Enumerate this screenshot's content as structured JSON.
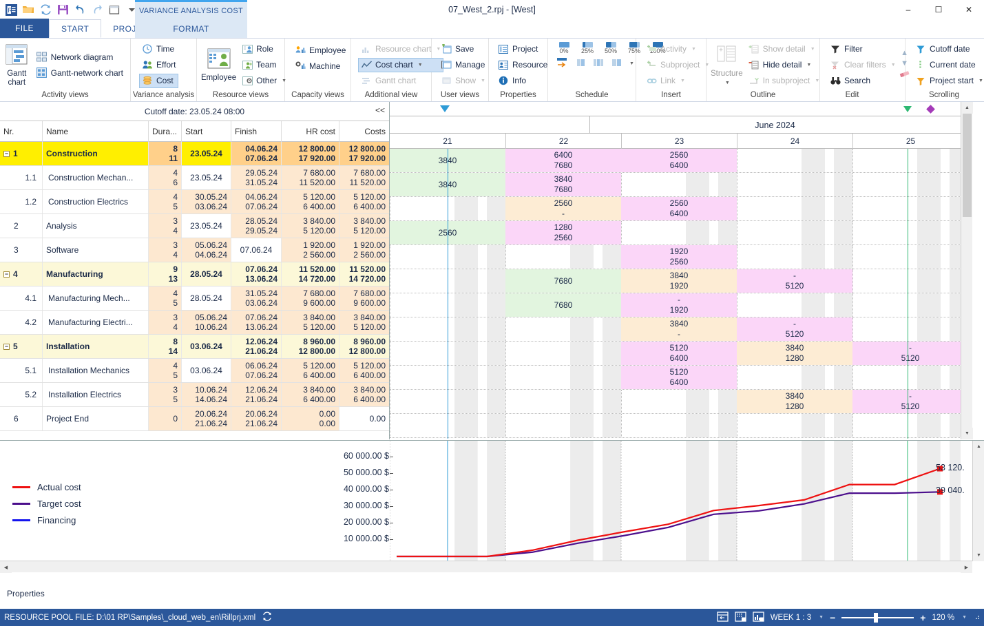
{
  "window": {
    "title": "07_West_2.rpj - [West]",
    "minimize": "–",
    "maximize": "☐",
    "close": "✕"
  },
  "quick_access": [
    {
      "name": "app-logo-icon",
      "label": "RP"
    },
    {
      "name": "open-icon",
      "label": "Open"
    },
    {
      "name": "refresh-icon",
      "label": "Refresh"
    },
    {
      "name": "save-icon",
      "label": "Save"
    },
    {
      "name": "undo-icon",
      "label": "Undo"
    },
    {
      "name": "redo-icon",
      "label": "Redo"
    },
    {
      "name": "window-icon",
      "label": "Window"
    },
    {
      "name": "qat-more-icon",
      "label": "More"
    }
  ],
  "tabs": {
    "file": "FILE",
    "items": [
      "START",
      "PROJECT"
    ],
    "active": "START",
    "contextual_title": "VARIANCE ANALYSIS COST",
    "contextual_tab": "FORMAT"
  },
  "ribbon": {
    "groups": [
      {
        "label": "Activity views",
        "big": {
          "label1": "Gantt",
          "label2": "chart",
          "icon": "gantt-chart-icon"
        },
        "items": [
          {
            "label": "Network diagram",
            "icon": "network-diagram-icon",
            "disabled": false,
            "caret": false
          },
          {
            "label": "Gantt-network chart",
            "icon": "gantt-network-icon",
            "disabled": false,
            "caret": false
          }
        ]
      },
      {
        "label": "Variance analysis",
        "items": [
          {
            "label": "Time",
            "icon": "clock-icon",
            "disabled": false,
            "caret": false
          },
          {
            "label": "Effort",
            "icon": "people-icon",
            "disabled": false,
            "caret": false
          },
          {
            "label": "Cost",
            "icon": "coins-icon",
            "disabled": false,
            "caret": false,
            "selected": true
          }
        ]
      },
      {
        "label": "Resource views",
        "big": {
          "label1": "Employee",
          "label2": "",
          "icon": "employee-grid-icon"
        },
        "items": [
          {
            "label": "Role",
            "icon": "role-icon",
            "disabled": false,
            "caret": false
          },
          {
            "label": "Team",
            "icon": "team-icon",
            "disabled": false,
            "caret": false
          },
          {
            "label": "Other",
            "icon": "other-icon",
            "disabled": false,
            "caret": true
          }
        ]
      },
      {
        "label": "Capacity views",
        "items": [
          {
            "label": "Employee",
            "icon": "employee-bars-icon",
            "disabled": false,
            "caret": false
          },
          {
            "label": "Machine",
            "icon": "machine-bars-icon",
            "disabled": false,
            "caret": false
          }
        ]
      },
      {
        "label": "Additional view",
        "items": [
          {
            "label": "Resource chart",
            "icon": "resource-chart-icon",
            "disabled": true,
            "caret": true
          },
          {
            "label": "Cost chart",
            "icon": "cost-chart-icon",
            "disabled": false,
            "caret": true,
            "selected": true
          },
          {
            "label": "Gantt chart",
            "icon": "gantt-small-icon",
            "disabled": true,
            "caret": false
          }
        ]
      },
      {
        "label": "User views",
        "items": [
          {
            "label": "Save",
            "icon": "save-view-icon",
            "disabled": false,
            "caret": false
          },
          {
            "label": "Manage",
            "icon": "manage-view-icon",
            "disabled": false,
            "caret": false
          },
          {
            "label": "Show",
            "icon": "show-view-icon",
            "disabled": true,
            "caret": true
          }
        ]
      },
      {
        "label": "Properties",
        "items": [
          {
            "label": "Project",
            "icon": "project-props-icon",
            "disabled": false,
            "caret": false
          },
          {
            "label": "Resource",
            "icon": "resource-props-icon",
            "disabled": false,
            "caret": false
          },
          {
            "label": "Info",
            "icon": "info-icon",
            "disabled": false,
            "caret": false
          }
        ]
      },
      {
        "label": "Schedule",
        "percents": [
          "0%",
          "25%",
          "50%",
          "75%",
          "100%"
        ]
      },
      {
        "label": "Insert",
        "items": [
          {
            "label": "Activity",
            "icon": "insert-activity-icon",
            "disabled": true,
            "caret": true
          },
          {
            "label": "Subproject",
            "icon": "insert-subproject-icon",
            "disabled": true,
            "caret": true
          },
          {
            "label": "Link",
            "icon": "insert-link-icon",
            "disabled": true,
            "caret": true
          }
        ]
      },
      {
        "label": "Outline",
        "big": {
          "label1": "Structure",
          "label2": "",
          "icon": "structure-icon",
          "caret": true
        },
        "items": [
          {
            "label": "Show detail",
            "icon": "show-detail-icon",
            "disabled": true,
            "caret": true
          },
          {
            "label": "Hide detail",
            "icon": "hide-detail-icon",
            "disabled": false,
            "caret": true
          },
          {
            "label": "In subproject",
            "icon": "in-subproject-icon",
            "disabled": true,
            "caret": true
          }
        ]
      },
      {
        "label": "Edit",
        "items": [
          {
            "label": "Filter",
            "icon": "filter-icon",
            "disabled": false,
            "caret": false
          },
          {
            "label": "Clear filters",
            "icon": "clear-filters-icon",
            "disabled": true,
            "caret": true
          },
          {
            "label": "Search",
            "icon": "binoculars-icon",
            "disabled": false,
            "caret": false
          }
        ],
        "side": [
          {
            "name": "scroll-up-icon",
            "label": "▲"
          },
          {
            "name": "scroll-down-icon",
            "label": "▼"
          },
          {
            "name": "eraser-icon",
            "label": ""
          }
        ]
      },
      {
        "label": "Scrolling",
        "items": [
          {
            "label": "Cutoff date",
            "icon": "cutoff-date-icon",
            "disabled": false,
            "caret": false
          },
          {
            "label": "Current date",
            "icon": "current-date-icon",
            "disabled": false,
            "caret": false
          },
          {
            "label": "Project start",
            "icon": "project-start-icon",
            "disabled": false,
            "caret": true
          }
        ]
      }
    ]
  },
  "table": {
    "cutoff_text": "Cutoff date: 23.05.24 08:00",
    "collapse_label": "<<",
    "columns": [
      "Nr.",
      "Name",
      "Dura...",
      "Start",
      "Finish",
      "HR cost",
      "Costs"
    ],
    "rows": [
      {
        "nr": "1",
        "name": "Construction",
        "dur1": "8",
        "dur2": "11",
        "start1": "23.05.24",
        "start2": "",
        "fin1": "04.06.24",
        "fin2": "07.06.24",
        "hr1": "12 800.00",
        "hr2": "17 920.00",
        "c1": "12 800.00",
        "c2": "17 920.00",
        "summary": true,
        "selected": true,
        "expander": true,
        "indent": 0
      },
      {
        "nr": "1.1",
        "name": "Construction Mechan...",
        "dur1": "4",
        "dur2": "6",
        "start1": "23.05.24",
        "start2": "",
        "fin1": "29.05.24",
        "fin2": "31.05.24",
        "hr1": "7 680.00",
        "hr2": "11 520.00",
        "c1": "7 680.00",
        "c2": "11 520.00",
        "summary": false,
        "selected": false,
        "expander": false,
        "indent": 1
      },
      {
        "nr": "1.2",
        "name": "Construction Electrics",
        "dur1": "4",
        "dur2": "5",
        "start1": "30.05.24",
        "start2": "03.06.24",
        "fin1": "04.06.24",
        "fin2": "07.06.24",
        "hr1": "5 120.00",
        "hr2": "6 400.00",
        "c1": "5 120.00",
        "c2": "6 400.00",
        "summary": false,
        "selected": false,
        "expander": false,
        "indent": 1
      },
      {
        "nr": "2",
        "name": "Analysis",
        "dur1": "3",
        "dur2": "4",
        "start1": "23.05.24",
        "start2": "",
        "fin1": "28.05.24",
        "fin2": "29.05.24",
        "hr1": "3 840.00",
        "hr2": "5 120.00",
        "c1": "3 840.00",
        "c2": "5 120.00",
        "summary": false,
        "selected": false,
        "expander": false,
        "indent": 0
      },
      {
        "nr": "3",
        "name": "Software",
        "dur1": "3",
        "dur2": "4",
        "start1": "05.06.24",
        "start2": "04.06.24",
        "fin1": "07.06.24",
        "fin2": "",
        "hr1": "1 920.00",
        "hr2": "2 560.00",
        "c1": "1 920.00",
        "c2": "2 560.00",
        "summary": false,
        "selected": false,
        "expander": false,
        "indent": 0
      },
      {
        "nr": "4",
        "name": "Manufacturing",
        "dur1": "9",
        "dur2": "13",
        "start1": "28.05.24",
        "start2": "",
        "fin1": "07.06.24",
        "fin2": "13.06.24",
        "hr1": "11 520.00",
        "hr2": "14 720.00",
        "c1": "11 520.00",
        "c2": "14 720.00",
        "summary": true,
        "selected": false,
        "expander": true,
        "indent": 0
      },
      {
        "nr": "4.1",
        "name": "Manufacturing Mech...",
        "dur1": "4",
        "dur2": "5",
        "start1": "28.05.24",
        "start2": "",
        "fin1": "31.05.24",
        "fin2": "03.06.24",
        "hr1": "7 680.00",
        "hr2": "9 600.00",
        "c1": "7 680.00",
        "c2": "9 600.00",
        "summary": false,
        "selected": false,
        "expander": false,
        "indent": 1
      },
      {
        "nr": "4.2",
        "name": "Manufacturing Electri...",
        "dur1": "3",
        "dur2": "4",
        "start1": "05.06.24",
        "start2": "10.06.24",
        "fin1": "07.06.24",
        "fin2": "13.06.24",
        "hr1": "3 840.00",
        "hr2": "5 120.00",
        "c1": "3 840.00",
        "c2": "5 120.00",
        "summary": false,
        "selected": false,
        "expander": false,
        "indent": 1
      },
      {
        "nr": "5",
        "name": "Installation",
        "dur1": "8",
        "dur2": "14",
        "start1": "03.06.24",
        "start2": "",
        "fin1": "12.06.24",
        "fin2": "21.06.24",
        "hr1": "8 960.00",
        "hr2": "12 800.00",
        "c1": "8 960.00",
        "c2": "12 800.00",
        "summary": true,
        "selected": false,
        "expander": true,
        "indent": 0
      },
      {
        "nr": "5.1",
        "name": "Installation Mechanics",
        "dur1": "4",
        "dur2": "5",
        "start1": "03.06.24",
        "start2": "",
        "fin1": "06.06.24",
        "fin2": "07.06.24",
        "hr1": "5 120.00",
        "hr2": "6 400.00",
        "c1": "5 120.00",
        "c2": "6 400.00",
        "summary": false,
        "selected": false,
        "expander": false,
        "indent": 1
      },
      {
        "nr": "5.2",
        "name": "Installation Electrics",
        "dur1": "3",
        "dur2": "5",
        "start1": "10.06.24",
        "start2": "14.06.24",
        "fin1": "12.06.24",
        "fin2": "21.06.24",
        "hr1": "3 840.00",
        "hr2": "6 400.00",
        "c1": "3 840.00",
        "c2": "6 400.00",
        "summary": false,
        "selected": false,
        "expander": false,
        "indent": 1
      },
      {
        "nr": "6",
        "name": "Project End",
        "dur1": "0",
        "dur2": "",
        "start1": "20.06.24",
        "start2": "21.06.24",
        "fin1": "20.06.24",
        "fin2": "21.06.24",
        "hr1": "0.00",
        "hr2": "0.00",
        "c1": "0.00",
        "c2": "",
        "summary": false,
        "selected": false,
        "expander": false,
        "indent": 0
      }
    ]
  },
  "timeline": {
    "month": "June 2024",
    "weeks": [
      "21",
      "22",
      "23",
      "24",
      "25"
    ],
    "cells": [
      [
        {
          "w": 0,
          "v1": "",
          "v2": "3840",
          "color": "green"
        },
        {
          "w": 1,
          "v1": "6400",
          "v2": "7680",
          "color": "pink"
        },
        {
          "w": 2,
          "v1": "2560",
          "v2": "6400",
          "color": "pink"
        }
      ],
      [
        {
          "w": 0,
          "v1": "",
          "v2": "3840",
          "color": "green"
        },
        {
          "w": 1,
          "v1": "3840",
          "v2": "7680",
          "color": "pink"
        }
      ],
      [
        {
          "w": 1,
          "v1": "2560",
          "v2": "-",
          "color": "peach"
        },
        {
          "w": 2,
          "v1": "2560",
          "v2": "6400",
          "color": "pink"
        }
      ],
      [
        {
          "w": 0,
          "v1": "",
          "v2": "2560",
          "color": "green"
        },
        {
          "w": 1,
          "v1": "1280",
          "v2": "2560",
          "color": "pink"
        }
      ],
      [
        {
          "w": 2,
          "v1": "1920",
          "v2": "2560",
          "color": "pink"
        }
      ],
      [
        {
          "w": 1,
          "v1": "",
          "v2": "7680",
          "color": "green"
        },
        {
          "w": 2,
          "v1": "3840",
          "v2": "1920",
          "color": "peach"
        },
        {
          "w": 3,
          "v1": "-",
          "v2": "5120",
          "color": "pink"
        }
      ],
      [
        {
          "w": 1,
          "v1": "",
          "v2": "7680",
          "color": "green"
        },
        {
          "w": 2,
          "v1": "-",
          "v2": "1920",
          "color": "pink"
        }
      ],
      [
        {
          "w": 2,
          "v1": "3840",
          "v2": "-",
          "color": "peach"
        },
        {
          "w": 3,
          "v1": "-",
          "v2": "5120",
          "color": "pink"
        }
      ],
      [
        {
          "w": 2,
          "v1": "5120",
          "v2": "6400",
          "color": "pink"
        },
        {
          "w": 3,
          "v1": "3840",
          "v2": "1280",
          "color": "peach"
        },
        {
          "w": 4,
          "v1": "-",
          "v2": "5120",
          "color": "pink"
        }
      ],
      [
        {
          "w": 2,
          "v1": "5120",
          "v2": "6400",
          "color": "pink"
        }
      ],
      [
        {
          "w": 3,
          "v1": "3840",
          "v2": "1280",
          "color": "peach"
        },
        {
          "w": 4,
          "v1": "-",
          "v2": "5120",
          "color": "pink"
        }
      ],
      []
    ]
  },
  "chart_data": {
    "type": "line",
    "title": "",
    "xlabel": "",
    "ylabel": "",
    "ylim": [
      0,
      65000
    ],
    "yticks": [
      "10 000.00 $",
      "20 000.00 $",
      "30 000.00 $",
      "40 000.00 $",
      "50 000.00 $",
      "60 000.00 $"
    ],
    "ytick_values": [
      10000,
      20000,
      30000,
      40000,
      50000,
      60000
    ],
    "grid": false,
    "legend_position": "left",
    "end_labels": [
      "53 120.",
      "39 040."
    ],
    "series": [
      {
        "name": "Actual cost",
        "color": "#ee1111",
        "end_label": "53 120.",
        "end_value": 53120,
        "x": [
          0,
          1,
          2,
          3,
          4,
          5,
          6,
          7,
          8,
          9,
          10,
          11,
          12
        ],
        "values": [
          0,
          0,
          0,
          3800,
          9800,
          14800,
          19500,
          27800,
          30800,
          34200,
          43500,
          43500,
          53120
        ]
      },
      {
        "name": "Target cost",
        "color": "#4b0e8c",
        "end_label": "39 040.",
        "end_value": 39040,
        "x": [
          0,
          1,
          2,
          3,
          4,
          5,
          6,
          7,
          8,
          9,
          10,
          11,
          12
        ],
        "values": [
          0,
          0,
          0,
          2600,
          8000,
          12500,
          17600,
          25500,
          27600,
          31800,
          38300,
          38300,
          39040
        ]
      },
      {
        "name": "Financing",
        "color": "#1414ee",
        "end_label": "",
        "end_value": 0,
        "x": [],
        "values": []
      }
    ]
  },
  "properties_bar": {
    "label": "Properties"
  },
  "statusbar": {
    "resource_pool": "RESOURCE POOL FILE: D:\\01 RP\\Samples\\_cloud_web_en\\Rillprj.xml",
    "refresh_icon": "refresh-icon",
    "view_icons": [
      "view-split-icon",
      "view-grid-icon",
      "view-chart-icon"
    ],
    "scale": "WEEK 1 : 3",
    "zoom_minus": "−",
    "zoom_plus": "+",
    "zoom_level": "120 %"
  }
}
